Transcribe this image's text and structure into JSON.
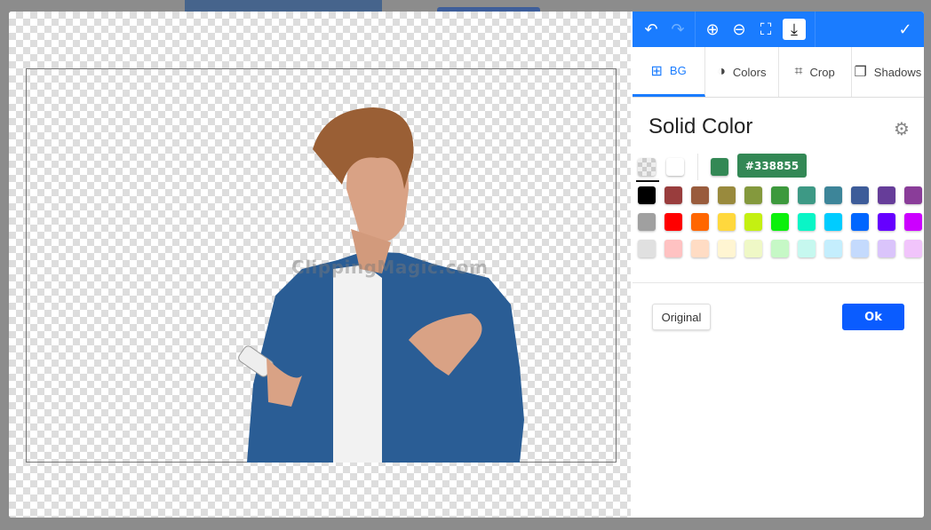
{
  "toolbar": {
    "icons": [
      "undo-icon",
      "redo-icon",
      "zoom-in-icon",
      "zoom-out-icon",
      "fit-icon",
      "download-icon",
      "check-icon"
    ]
  },
  "tabs": [
    {
      "label": "BG",
      "icon": "grid-icon",
      "active": true
    },
    {
      "label": "Colors",
      "icon": "half-circle-icon"
    },
    {
      "label": "Crop",
      "icon": "crop-icon"
    },
    {
      "label": "Shadows",
      "icon": "shadow-icon"
    }
  ],
  "panel": {
    "title": "Solid Color",
    "hex": "#338855",
    "selected_color": "#338855",
    "original_label": "Original",
    "ok_label": "Ok"
  },
  "canvas": {
    "watermark": "ClippingMagic.com"
  },
  "palette": [
    "#000000",
    "#993d3d",
    "#995c3d",
    "#998a3d",
    "#84993d",
    "#3d993d",
    "#3d9985",
    "#3d8599",
    "#3d5c99",
    "#663d99",
    "#8a3d99",
    "#a0a0a0",
    "#ff0000",
    "#ff6600",
    "#ffd83d",
    "#c4f012",
    "#0cf00c",
    "#0af5c6",
    "#00ccff",
    "#0066ff",
    "#6600ff",
    "#cc00ff",
    "#e0e0e0",
    "#ffc2c2",
    "#ffdcc4",
    "#fff5d2",
    "#eff8c6",
    "#c6f8c6",
    "#c6f8ef",
    "#c4eefd",
    "#c4dafd",
    "#dac4fb",
    "#f1c4fb"
  ]
}
